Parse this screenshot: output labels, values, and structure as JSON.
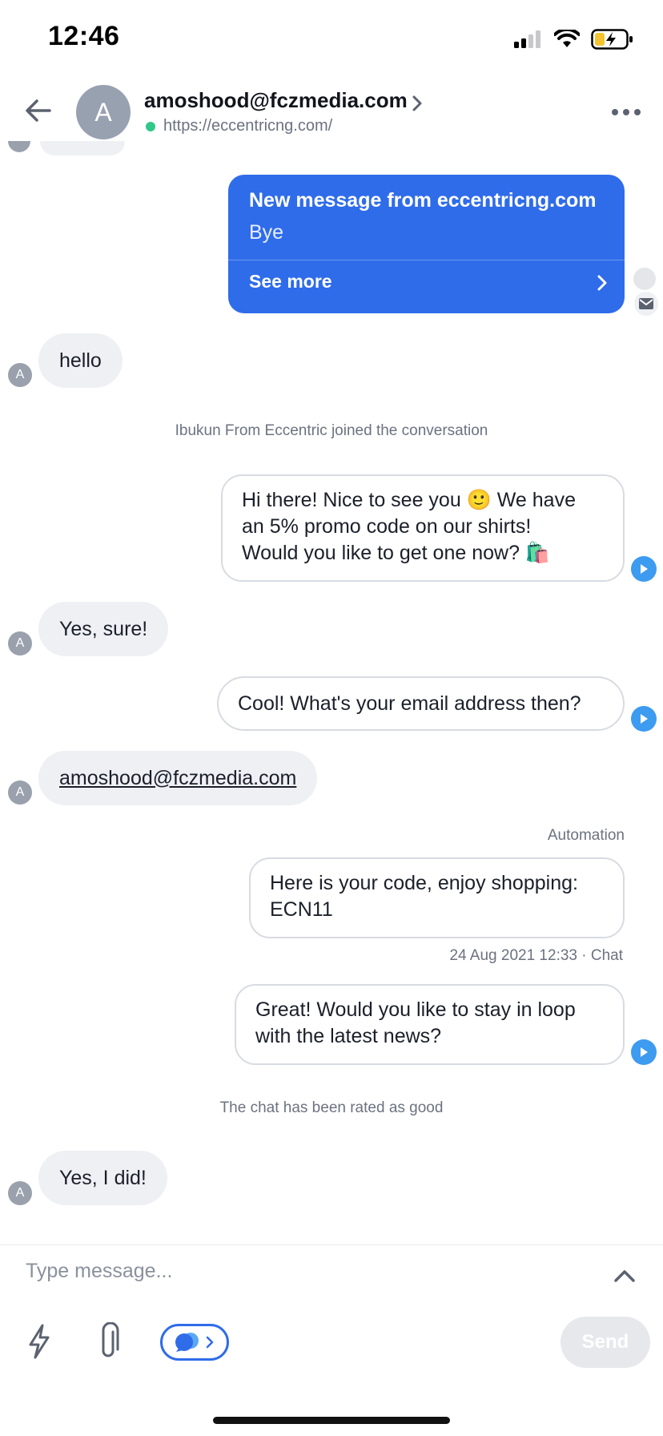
{
  "status_bar": {
    "time": "12:46"
  },
  "header": {
    "avatar_letter": "A",
    "contact_name": "amoshood@fczmedia.com",
    "url": "https://eccentricng.com/"
  },
  "messages": {
    "card": {
      "title": "New message from eccentricng.com",
      "body": "Bye",
      "link": "See more"
    },
    "m1": "hello",
    "sys1": "Ibukun From Eccentric joined the conversation",
    "m2_line1": "Hi there! Nice to see you 🙂 We have",
    "m2_line2": "an 5% promo code on our shirts!",
    "m2_line3": "Would you like to get one now? 🛍️",
    "m3": "Yes, sure!",
    "m4": "Cool! What's your email address then?",
    "m5": "amoshood@fczmedia.com",
    "automation_label": "Automation",
    "m6_line1": "Here is your code, enjoy shopping:",
    "m6_line2": "ECN11",
    "m6_meta": "24 Aug 2021 12:33 · Chat",
    "m7_line1": "Great! Would you like to stay in loop",
    "m7_line2": "with the latest news?",
    "sys2": "The chat has been rated as good",
    "m8": "Yes, I did!",
    "avatar_letter": "A"
  },
  "composer": {
    "placeholder": "Type message...",
    "send_label": "Send"
  }
}
